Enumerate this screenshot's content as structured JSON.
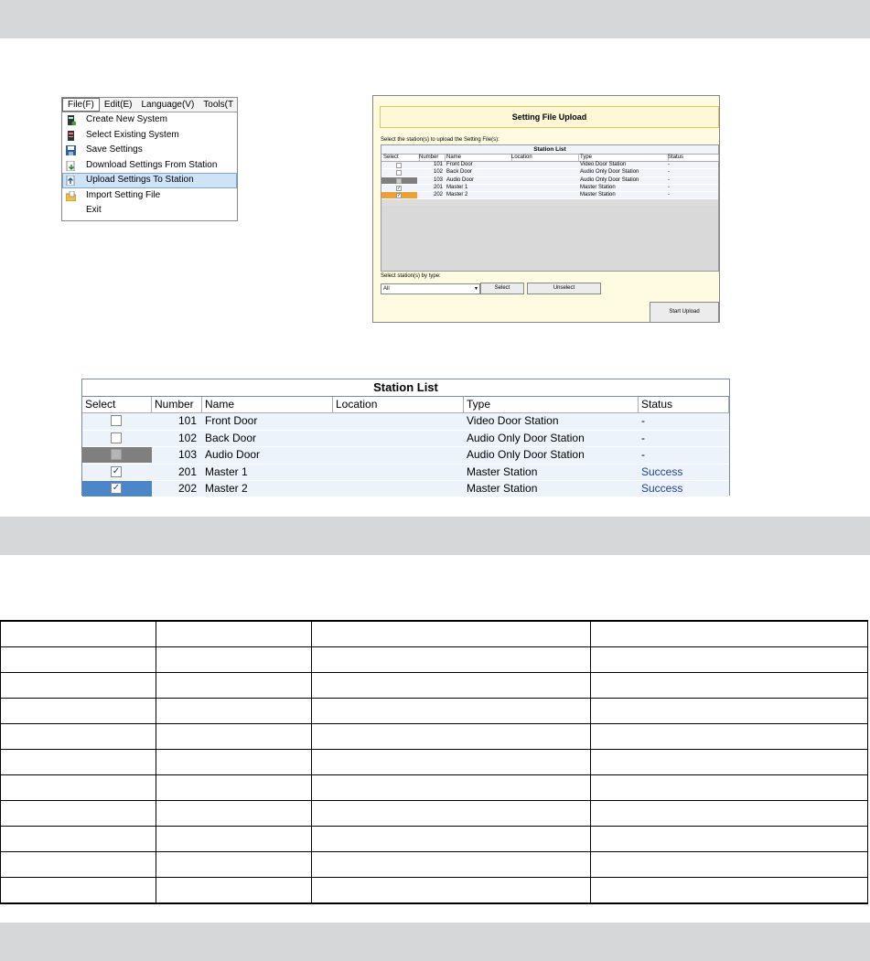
{
  "menu": {
    "bar": [
      {
        "label": "File(F)",
        "active": true
      },
      {
        "label": "Edit(E)",
        "active": false
      },
      {
        "label": "Language(V)",
        "active": false
      },
      {
        "label": "Tools(T",
        "active": false
      }
    ],
    "items": [
      {
        "label": "Create New System",
        "icon": "new-system-icon",
        "highlight": false
      },
      {
        "label": "Select Existing System",
        "icon": "existing-system-icon",
        "highlight": false
      },
      {
        "label": "Save Settings",
        "icon": "save-icon",
        "highlight": false
      },
      {
        "label": "Download Settings From Station",
        "icon": "download-icon",
        "highlight": false
      },
      {
        "label": "Upload Settings To Station",
        "icon": "upload-icon",
        "highlight": true
      },
      {
        "label": "Import Setting File",
        "icon": "import-folder-icon",
        "highlight": false
      },
      {
        "label": "Exit",
        "icon": "",
        "highlight": false
      }
    ]
  },
  "dialog": {
    "title": "Setting File Upload",
    "prompt": "Select the station(s) to upload the Setting File(s):",
    "list_title": "Station List",
    "columns": [
      "Select",
      "Number",
      "Name",
      "Location",
      "Type",
      "Status"
    ],
    "rows": [
      {
        "sel": "unchecked",
        "number": "101",
        "name": "Front Door",
        "location": "",
        "type": "Video Door Station",
        "status": "-"
      },
      {
        "sel": "unchecked",
        "number": "102",
        "name": "Back Door",
        "location": "",
        "type": "Audio Only Door Station",
        "status": "-"
      },
      {
        "sel": "disabled",
        "number": "103",
        "name": "Audio Door",
        "location": "",
        "type": "Audio Only Door Station",
        "status": "-"
      },
      {
        "sel": "checked",
        "number": "201",
        "name": "Master 1",
        "location": "",
        "type": "Master Station",
        "status": "-"
      },
      {
        "sel": "checked-highlight",
        "number": "202",
        "name": "Master 2",
        "location": "",
        "type": "Master Station",
        "status": "-"
      }
    ],
    "by_type_label": "Select station(s) by type:",
    "dropdown_value": "All",
    "select_button": "Select",
    "unselect_button": "Unselect",
    "start_button": "Start Upload"
  },
  "station_list": {
    "title": "Station List",
    "columns": [
      "Select",
      "Number",
      "Name",
      "Location",
      "Type",
      "Status"
    ],
    "rows": [
      {
        "sel": "unchecked",
        "number": "101",
        "name": "Front Door",
        "location": "",
        "type": "Video Door Station",
        "status": "-"
      },
      {
        "sel": "unchecked",
        "number": "102",
        "name": "Back Door",
        "location": "",
        "type": "Audio Only Door Station",
        "status": "-"
      },
      {
        "sel": "disabled",
        "number": "103",
        "name": "Audio Door",
        "location": "",
        "type": "Audio Only Door Station",
        "status": "-"
      },
      {
        "sel": "checked",
        "number": "201",
        "name": "Master 1",
        "location": "",
        "type": "Master Station",
        "status": "Success"
      },
      {
        "sel": "checked-highlight",
        "number": "202",
        "name": "Master 2",
        "location": "",
        "type": "Master Station",
        "status": "Success"
      }
    ]
  },
  "blank_table": {
    "rows": 11,
    "cols": 4
  },
  "colors": {
    "band": "#d6d7d9",
    "row_bg": "#edf3fb",
    "disabled_cell": "#7f7f7f",
    "orange_highlight": "#f0a030",
    "blue_highlight": "#4a86c8",
    "success_text": "#1f3f96"
  }
}
